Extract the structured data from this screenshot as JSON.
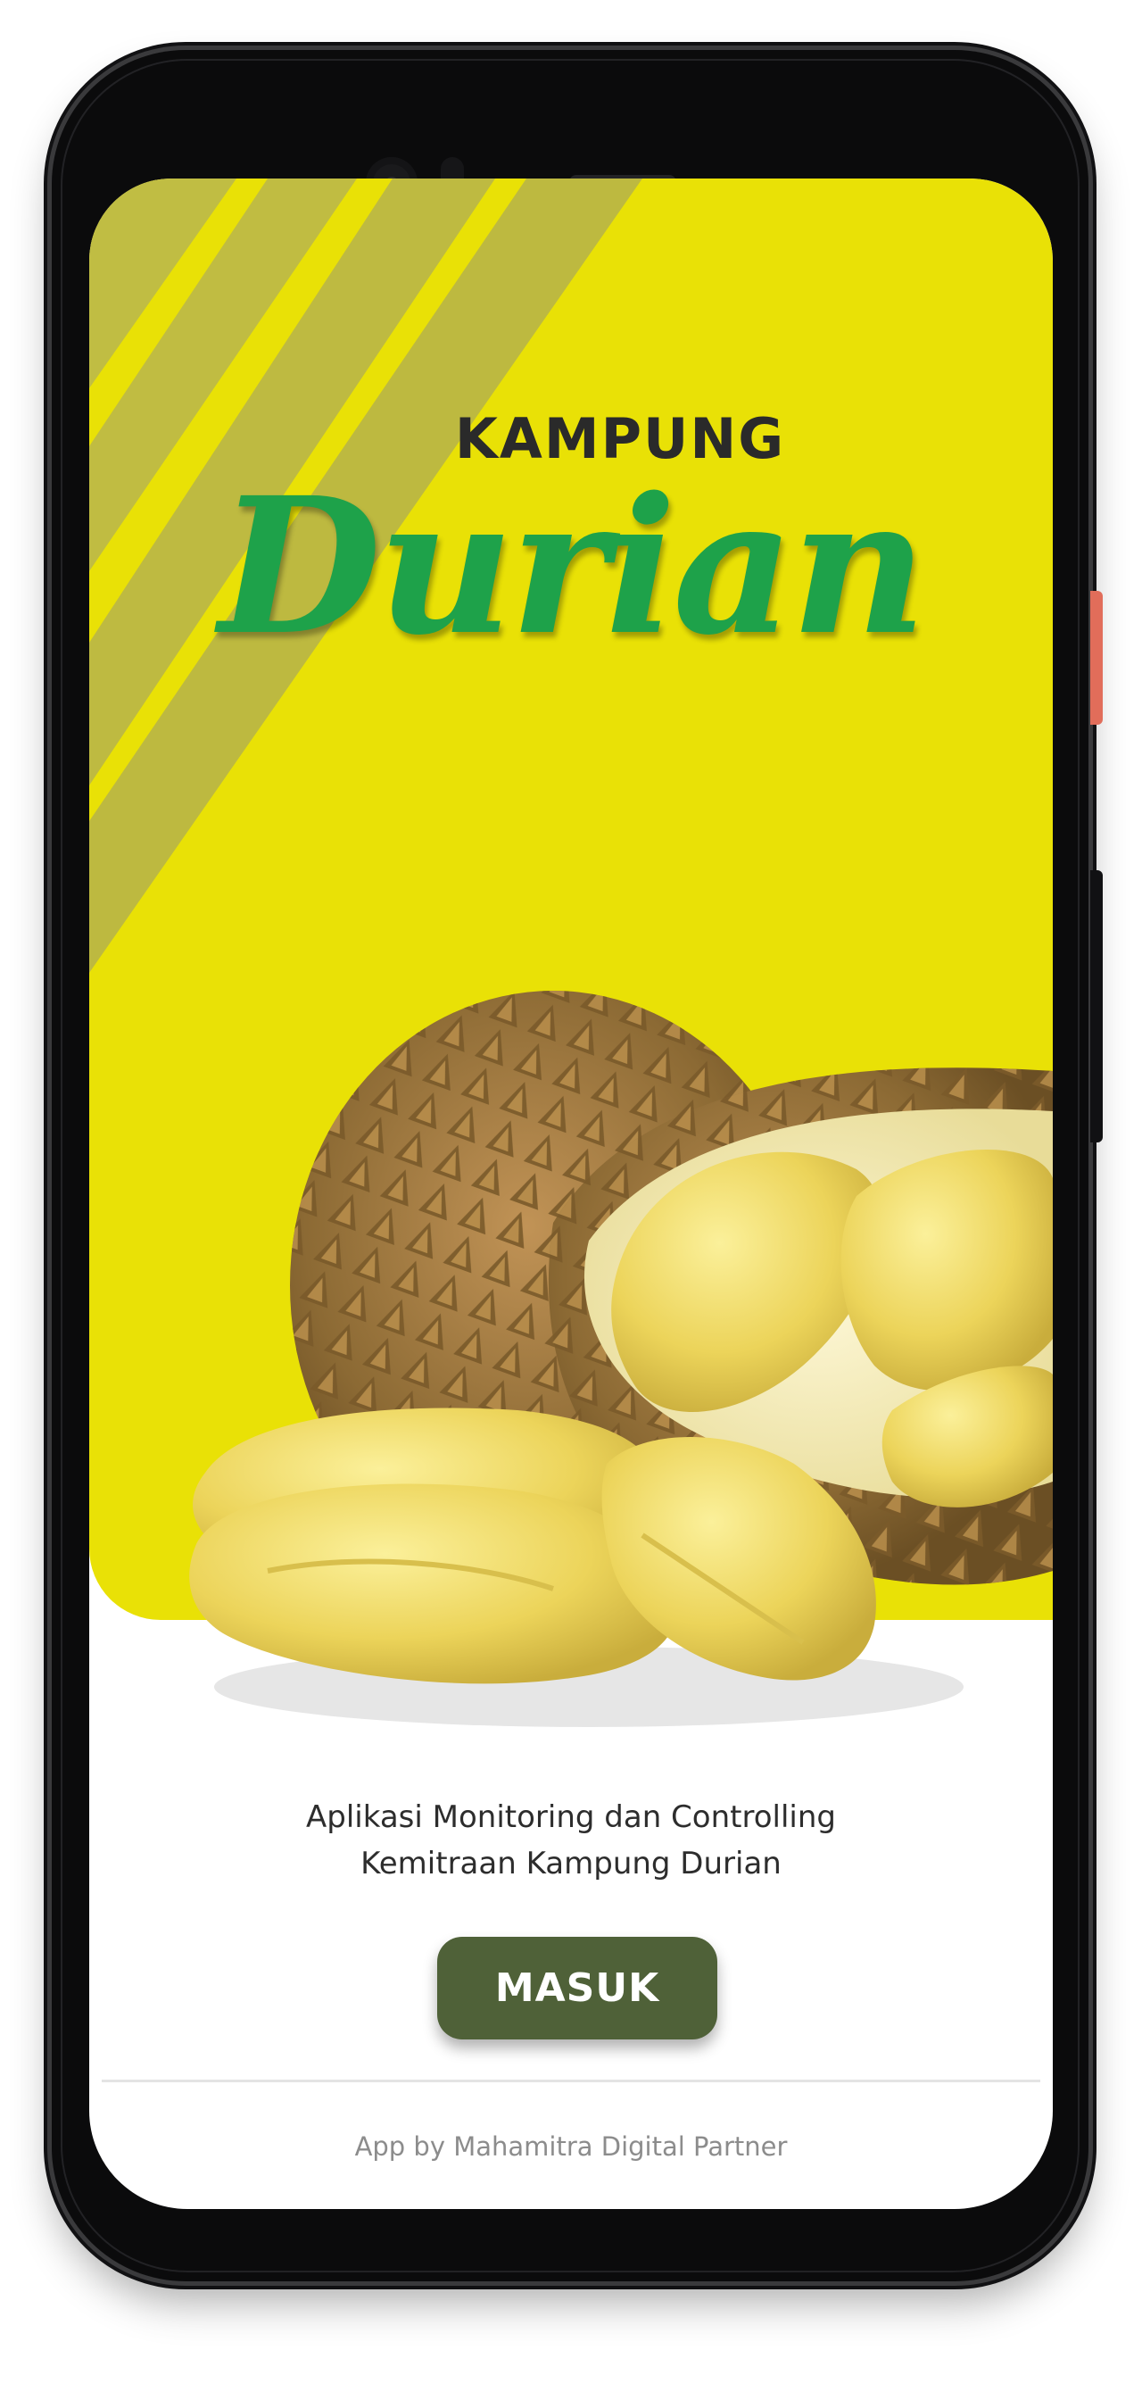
{
  "app": {
    "brand_prefix": "KAMPUNG",
    "brand_name": "Durian"
  },
  "welcome": {
    "tagline_line1": "Aplikasi Monitoring dan Controlling",
    "tagline_line2": "Kemitraan Kampung Durian",
    "login_button": "MASUK",
    "credit": "App by Mahamitra Digital Partner"
  },
  "colors": {
    "hero_background": "#e9e106",
    "brand_script": "#1ea24a",
    "button": "#4f6138",
    "side_button": "#e16d5a"
  },
  "images": {
    "hero_illustration": "durian-fruit-illustration"
  }
}
